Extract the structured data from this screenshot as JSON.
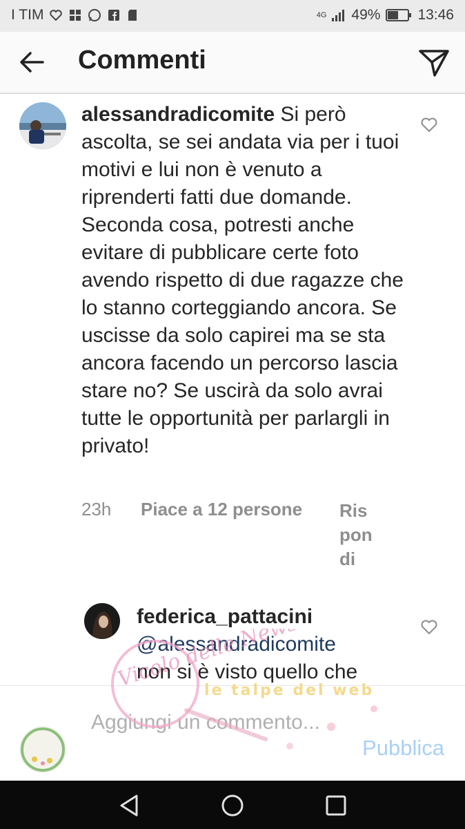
{
  "status_bar": {
    "carrier": "I TIM",
    "network": "4G",
    "battery": "49%",
    "time": "13:46"
  },
  "header": {
    "title": "Commenti",
    "back_icon": "arrow-left-icon",
    "direct_icon": "paper-plane-icon"
  },
  "comments": [
    {
      "username": "alessandradicomite",
      "text": " Si però ascolta, se sei andata via per i tuoi motivi e lui non è venuto a riprenderti fatti due domande. Seconda cosa, potresti anche evitare di pubblicare certe foto avendo rispetto di due ragazze che lo stanno corteggiando ancora. Se uscisse da solo capirei ma se sta ancora facendo un percorso lascia stare no? Se uscirà da solo avrai tutte le opportunità per parlargli in privato!",
      "time": "23h",
      "likes": "Piace a 12 persone",
      "reply": "Ris pon di"
    },
    {
      "username": "federica_pattacini",
      "mention": "@alessandradicomite",
      "text": "non si è visto quello che"
    }
  ],
  "composer": {
    "placeholder": "Aggiungi un commento...",
    "publish": "Pubblica"
  },
  "watermark": {
    "line1": "Vicolo delle News",
    "line2": "le talpe del web"
  },
  "colors": {
    "status_bar_bg": "#ebebeb",
    "publish_disabled": "#a9d0f5",
    "meta_gray": "#8e8e8e",
    "nav_bg": "#0a0a0a"
  }
}
